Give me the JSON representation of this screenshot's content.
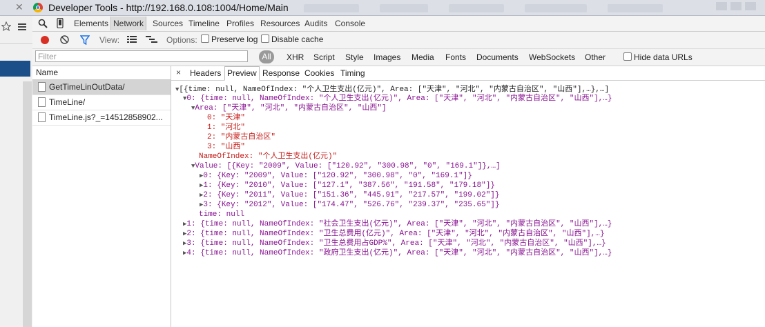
{
  "window": {
    "title": "Developer Tools - http://192.168.0.108:1004/Home/Main",
    "close_glyph": "✕"
  },
  "devtools": {
    "tabs": [
      "Elements",
      "Network",
      "Sources",
      "Timeline",
      "Profiles",
      "Resources",
      "Audits",
      "Console"
    ],
    "active_tab": "Network"
  },
  "network_bar": {
    "view_label": "View:",
    "options_label": "Options:",
    "preserve_log": "Preserve log",
    "disable_cache": "Disable cache"
  },
  "filter_bar": {
    "placeholder": "Filter",
    "all_label": "All",
    "types": [
      "XHR",
      "Script",
      "Style",
      "Images",
      "Media",
      "Fonts",
      "Documents",
      "WebSockets",
      "Other"
    ],
    "hide_data_urls": "Hide data URLs"
  },
  "request_list": {
    "header": "Name",
    "items": [
      "GetTimeLinOutData/",
      "TimeLine/",
      "TimeLine.js?_=14512858902..."
    ],
    "selected_index": 0
  },
  "detail": {
    "close_glyph": "×",
    "tabs": [
      "Headers",
      "Preview",
      "Response",
      "Cookies",
      "Timing"
    ],
    "active_tab": "Preview"
  },
  "json_preview": {
    "root": "[{time: null, NameOfIndex: \"个人卫生支出(亿元)\", Area: [\"天津\", \"河北\", \"内蒙古自治区\", \"山西\"],…},…]",
    "item0": "0: {time: null, NameOfIndex: \"个人卫生支出(亿元)\", Area: [\"天津\", \"河北\", \"内蒙古自治区\", \"山西\"],…}",
    "area_summary": "Area: [\"天津\", \"河北\", \"内蒙古自治区\", \"山西\"]",
    "area_items": [
      "0: \"天津\"",
      "1: \"河北\"",
      "2: \"内蒙古自治区\"",
      "3: \"山西\""
    ],
    "name_of_index": "NameOfIndex: \"个人卫生支出(亿元)\"",
    "value_summary": "Value: [{Key: \"2009\", Value: [\"120.92\", \"300.98\", \"0\", \"169.1\"]},…]",
    "value_items": [
      "0: {Key: \"2009\", Value: [\"120.92\", \"300.98\", \"0\", \"169.1\"]}",
      "1: {Key: \"2010\", Value: [\"127.1\", \"387.56\", \"191.58\", \"179.18\"]}",
      "2: {Key: \"2011\", Value: [\"151.36\", \"445.91\", \"217.57\", \"199.02\"]}",
      "3: {Key: \"2012\", Value: [\"174.47\", \"526.76\", \"239.37\", \"235.65\"]}"
    ],
    "time_line": "time: null",
    "other_items": [
      "1: {time: null, NameOfIndex: \"社会卫生支出(亿元)\", Area: [\"天津\", \"河北\", \"内蒙古自治区\", \"山西\"],…}",
      "2: {time: null, NameOfIndex: \"卫生总费用(亿元)\", Area: [\"天津\", \"河北\", \"内蒙古自治区\", \"山西\"],…}",
      "3: {time: null, NameOfIndex: \"卫生总费用占GDP%\", Area: [\"天津\", \"河北\", \"内蒙古自治区\", \"山西\"],…}",
      "4: {time: null, NameOfIndex: \"政府卫生支出(亿元)\", Area: [\"天津\", \"河北\", \"内蒙古自治区\", \"山西\"],…}"
    ]
  }
}
